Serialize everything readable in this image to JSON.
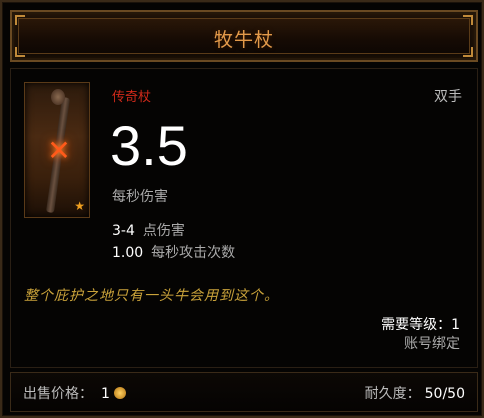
{
  "item": {
    "name": "牧牛杖",
    "type": "传奇杖",
    "hands": "双手",
    "dps": "3.5",
    "dps_label": "每秒伤害",
    "damage_range": "3-4",
    "damage_label": "点伤害",
    "attack_speed": "1.00",
    "attack_speed_label": "每秒攻击次数",
    "flavor_text": "整个庇护之地只有一头牛会用到这个。",
    "required_level": "需要等级：1",
    "binding": "账号绑定",
    "sell_label": "出售价格：",
    "sell_value": "1",
    "durability_label": "耐久度：",
    "durability_value": "50/50"
  },
  "colors": {
    "title": "#e39a4a",
    "legendary": "#d02a1a",
    "flavor": "#c9a23a"
  },
  "icons": {
    "portrait_mark": "cross-icon",
    "rarity": "star-icon",
    "currency": "gold-coin-icon"
  }
}
